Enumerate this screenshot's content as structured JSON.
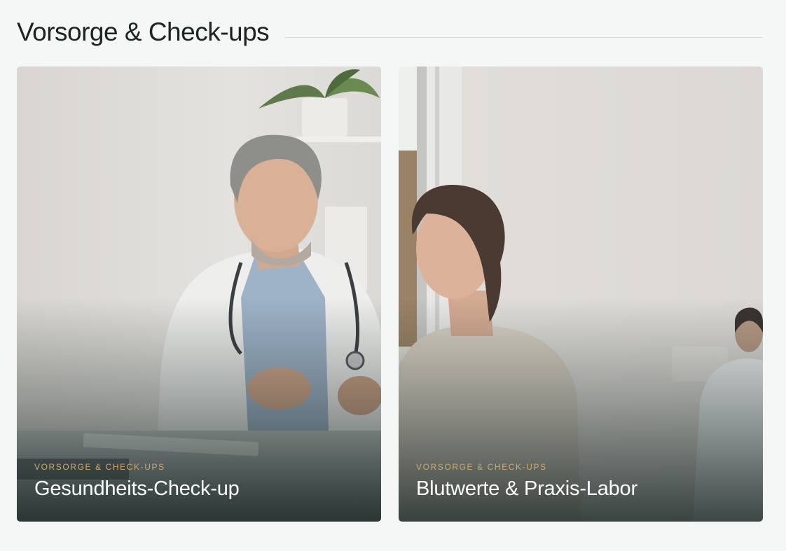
{
  "section": {
    "title": "Vorsorge & Check-ups"
  },
  "cards": [
    {
      "eyebrow": "VORSORGE & CHECK-UPS",
      "title": "Gesundheits-Check-up",
      "image": "doctor-consultation-photo"
    },
    {
      "eyebrow": "VORSORGE & CHECK-UPS",
      "title": "Blutwerte & Praxis-Labor",
      "image": "woman-waiting-room-photo"
    }
  ],
  "colors": {
    "background": "#f5f7f6",
    "heading": "#1a2421",
    "eyebrow": "#d1a968",
    "card_title": "#ffffff"
  }
}
